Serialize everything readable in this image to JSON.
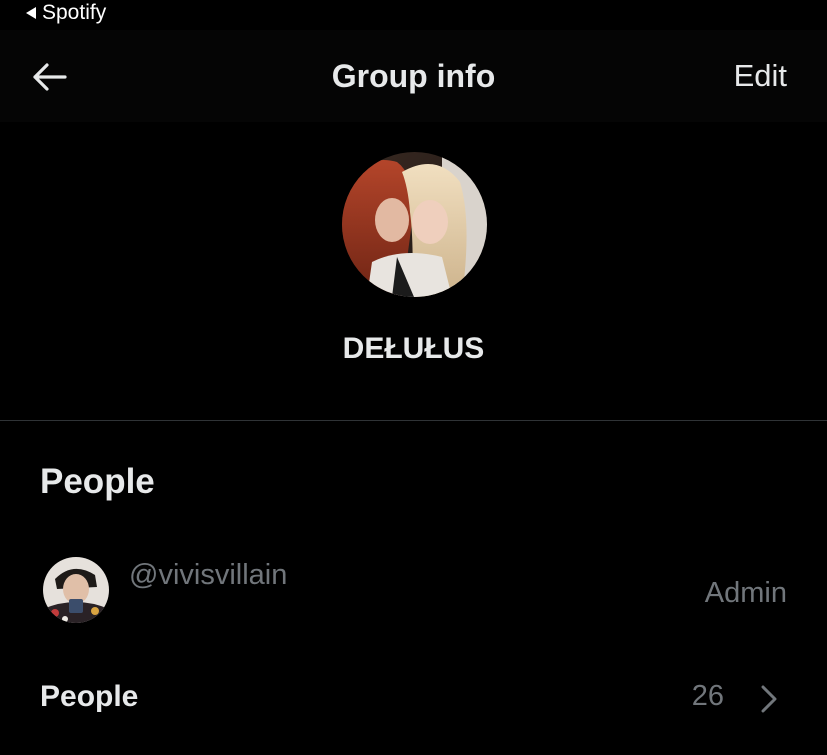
{
  "status_bar": {
    "back_app": "Spotify"
  },
  "nav": {
    "title": "Group info",
    "edit_label": "Edit"
  },
  "group": {
    "name": "DEŁUŁUS"
  },
  "people_section": {
    "heading": "People",
    "members": [
      {
        "handle": "@vivisvillain",
        "role": "Admin"
      }
    ]
  },
  "people_row": {
    "label": "People",
    "count": "26"
  },
  "colors": {
    "background": "#000000",
    "primary_text": "#e7e9ea",
    "secondary_text": "#71767b",
    "divider": "#2f3336"
  },
  "icons": {
    "back": "back-arrow-icon",
    "chevron": "chevron-right-icon",
    "status_back": "back-triangle-icon"
  }
}
